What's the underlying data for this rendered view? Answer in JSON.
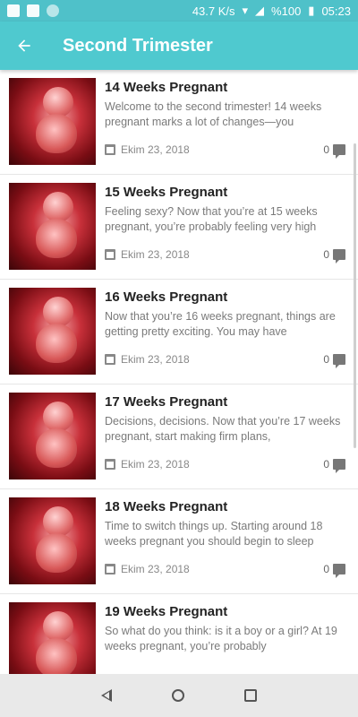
{
  "status_bar": {
    "speed": "43.7 K/s",
    "battery": "%100",
    "time": "05:23"
  },
  "app_bar": {
    "title": "Second Trimester"
  },
  "items": [
    {
      "title": "14 Weeks Pregnant",
      "desc": "Welcome to the second trimester! 14 weeks pregnant marks a lot of changes—you",
      "date": "Ekim 23, 2018",
      "comments": "0"
    },
    {
      "title": "15 Weeks Pregnant",
      "desc": "Feeling sexy? Now that you’re at 15 weeks pregnant, you’re probably feeling very high",
      "date": "Ekim 23, 2018",
      "comments": "0"
    },
    {
      "title": "16 Weeks Pregnant",
      "desc": "Now that you’re 16 weeks pregnant, things are getting pretty exciting. You may have",
      "date": "Ekim 23, 2018",
      "comments": "0"
    },
    {
      "title": "17 Weeks Pregnant",
      "desc": "Decisions, decisions. Now that you’re 17 weeks pregnant, start making firm plans,",
      "date": "Ekim 23, 2018",
      "comments": "0"
    },
    {
      "title": "18 Weeks Pregnant",
      "desc": "Time to switch things up. Starting around 18 weeks pregnant you should begin to sleep",
      "date": "Ekim 23, 2018",
      "comments": "0"
    },
    {
      "title": "19 Weeks Pregnant",
      "desc": "So what do you think: is it a boy or a girl? At 19 weeks pregnant, you’re probably",
      "date": "",
      "comments": ""
    }
  ]
}
